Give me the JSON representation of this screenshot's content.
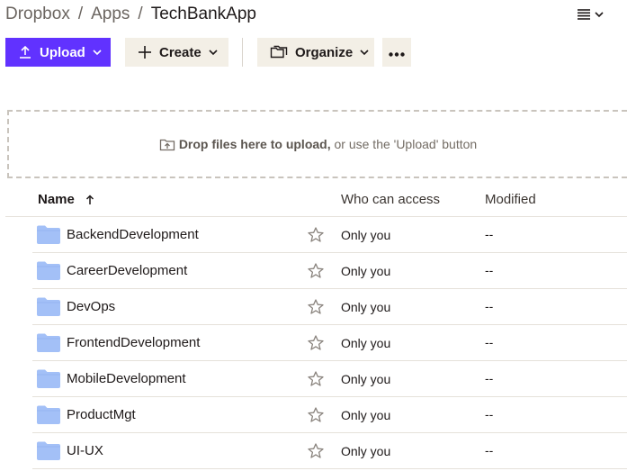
{
  "breadcrumb": {
    "root": "Dropbox",
    "sep1": "/",
    "parent": "Apps",
    "sep2": "/",
    "current": "TechBankApp"
  },
  "view_toggle": {
    "icon": "list-view-icon",
    "caret_icon": "chevron-down-icon"
  },
  "toolbar": {
    "upload_label": "Upload",
    "create_label": "Create",
    "organize_label": "Organize",
    "more_icon": "more-horizontal-icon"
  },
  "dropzone": {
    "strong": "Drop files here to upload,",
    "rest": " or use the 'Upload' button"
  },
  "table": {
    "columns": {
      "name": "Name",
      "access": "Who can access",
      "modified": "Modified"
    },
    "rows": [
      {
        "name": "BackendDevelopment",
        "access": "Only you",
        "modified": "--"
      },
      {
        "name": "CareerDevelopment",
        "access": "Only you",
        "modified": "--"
      },
      {
        "name": "DevOps",
        "access": "Only you",
        "modified": "--"
      },
      {
        "name": "FrontendDevelopment",
        "access": "Only you",
        "modified": "--"
      },
      {
        "name": "MobileDevelopment",
        "access": "Only you",
        "modified": "--"
      },
      {
        "name": "ProductMgt",
        "access": "Only you",
        "modified": "--"
      },
      {
        "name": "UI-UX",
        "access": "Only you",
        "modified": "--"
      }
    ]
  },
  "colors": {
    "accent": "#6132ff",
    "secondary_button": "#f3efe6",
    "folder": "#a3c0f7"
  }
}
